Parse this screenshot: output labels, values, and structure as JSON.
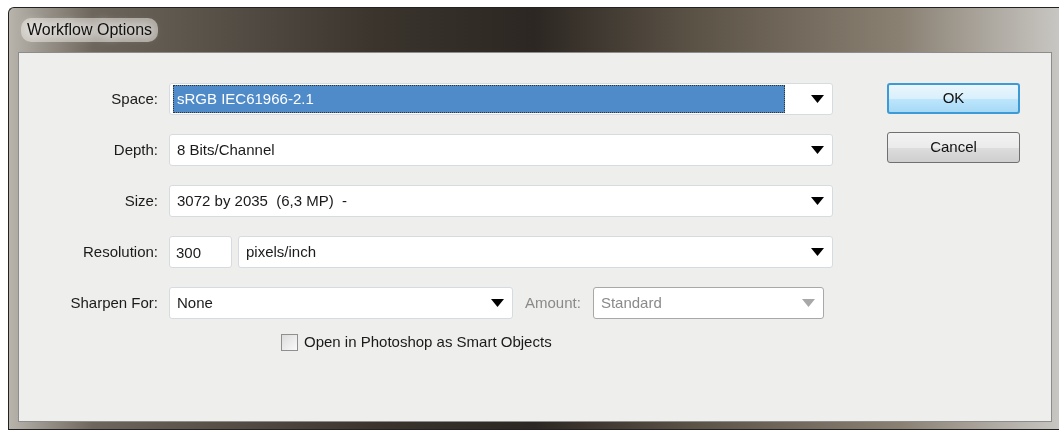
{
  "window": {
    "title": "Workflow Options"
  },
  "rows": [
    {
      "label": "Space:",
      "controls": [
        {
          "kind": "select",
          "value": "sRGB IEC61966-2.1",
          "highlighted": true,
          "disabled": false
        }
      ]
    },
    {
      "label": "Depth:",
      "controls": [
        {
          "kind": "select",
          "value": "8 Bits/Channel",
          "highlighted": false,
          "disabled": false
        }
      ]
    },
    {
      "label": "Size:",
      "controls": [
        {
          "kind": "select",
          "value": "3072 by 2035  (6,3 MP)  -",
          "highlighted": false,
          "disabled": false
        }
      ]
    },
    {
      "label": "Resolution:",
      "controls": [
        {
          "kind": "input",
          "value": "300"
        },
        {
          "kind": "select",
          "value": "pixels/inch",
          "highlighted": false,
          "disabled": false
        }
      ]
    },
    {
      "label": "Sharpen For:",
      "controls": [
        {
          "kind": "select",
          "value": "None",
          "highlighted": false,
          "disabled": false
        },
        {
          "kind": "label",
          "text": "Amount:",
          "disabled": true
        },
        {
          "kind": "select",
          "value": "Standard",
          "highlighted": false,
          "disabled": true
        }
      ]
    }
  ],
  "checkbox": {
    "label": "Open in Photoshop as Smart Objects",
    "checked": false
  },
  "buttons": [
    {
      "label": "OK",
      "default": true
    },
    {
      "label": "Cancel",
      "default": false
    }
  ]
}
